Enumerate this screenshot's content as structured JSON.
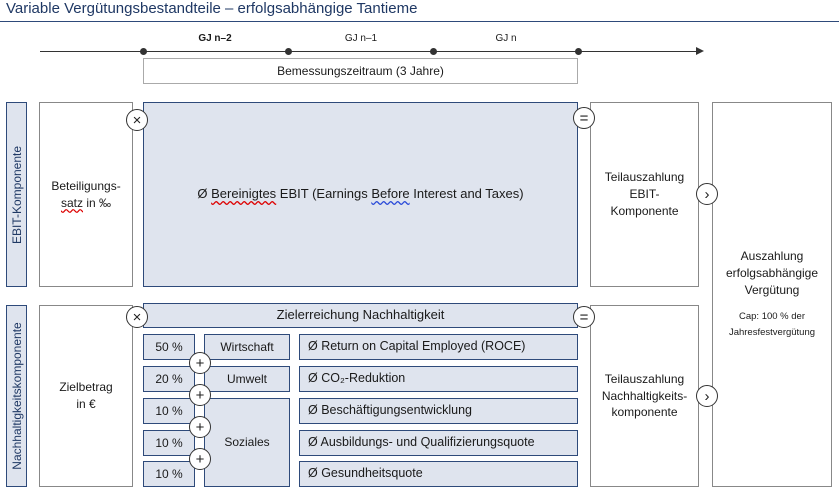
{
  "title": "Variable Vergütungsbestandteile – erfolgsabhängige Tantieme",
  "timeline": {
    "years": [
      "GJ n–2",
      "GJ n–1",
      "GJ n"
    ],
    "period_label": "Bemessungszeitraum (3 Jahre)"
  },
  "ebit": {
    "side_label": "EBIT-Komponente",
    "factor_line1": "Beteiligungs-",
    "factor_line2_a": "satz",
    "factor_line2_b": " in ‰",
    "main_prefix": "Ø ",
    "main_word1": "Bereinigtes",
    "main_mid": " EBIT (Earnings ",
    "main_word2": "Before",
    "main_suffix": " Interest and Taxes)",
    "result_line1": "Teilauszahlung",
    "result_line2": "EBIT-",
    "result_line3": "Komponente"
  },
  "sustainability": {
    "side_label": "Nachhaltigkeitskomponente",
    "factor_line1": "Zielbetrag",
    "factor_line2": "in €",
    "header": "Zielerreichung Nachhaltigkeit",
    "categories": [
      "Wirtschaft",
      "Umwelt",
      "Soziales"
    ],
    "weights": [
      "50 %",
      "20 %",
      "10 %",
      "10 %",
      "10 %"
    ],
    "kpis": [
      "Ø Return on Capital Employed (ROCE)",
      "Ø CO₂-Reduktion",
      "Ø Beschäftigungsentwicklung",
      "Ø Ausbildungs- und Qualifizierungsquote",
      "Ø Gesundheitsquote"
    ],
    "result_line1": "Teilauszahlung",
    "result_line2": "Nachhaltigkeits-",
    "result_line3": "komponente"
  },
  "payout": {
    "line1": "Auszahlung",
    "line2": "erfolgsabhängige",
    "line3": "Vergütung",
    "cap_line1": "Cap: 100 % der",
    "cap_line2": "Jahresfestvergütung"
  },
  "operators": {
    "multiply": "×",
    "equals": "=",
    "plus": "+",
    "arrow": "›"
  }
}
